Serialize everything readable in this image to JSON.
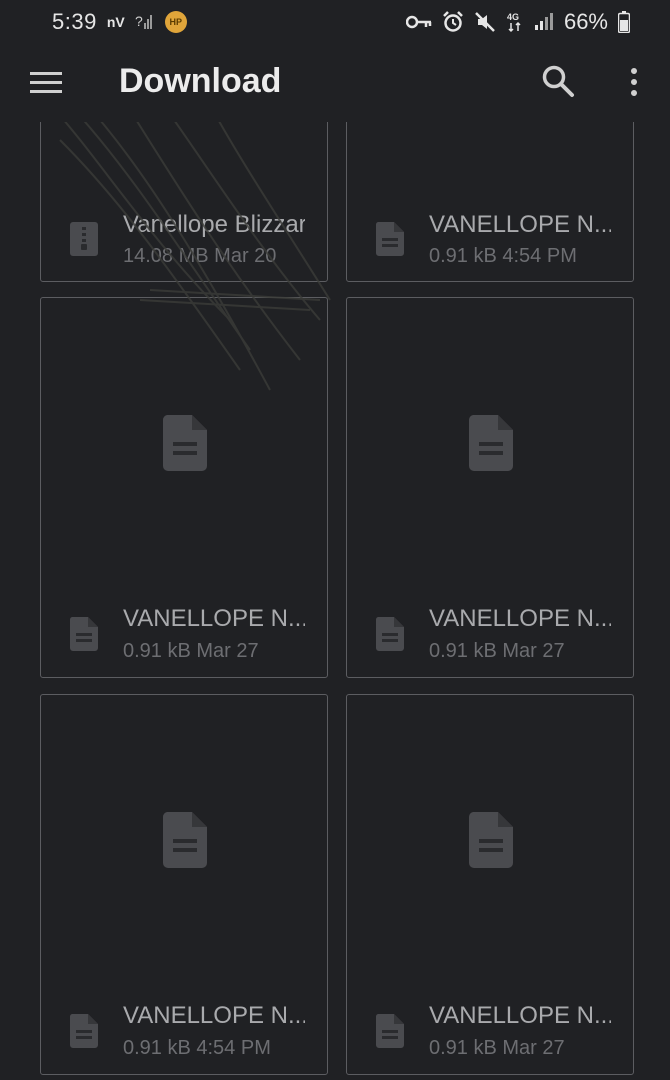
{
  "status_bar": {
    "time": "5:39",
    "carrier": "nV",
    "badge": "HP",
    "network": "4G",
    "battery": "66%"
  },
  "app_bar": {
    "title": "Download"
  },
  "files": [
    {
      "name": "Vanellope Blizzard S...",
      "meta": "14.08 MB Mar 20",
      "type": "zip"
    },
    {
      "name": "VANELLOPE N...",
      "meta": "0.91 kB 4:54 PM",
      "type": "doc"
    },
    {
      "name": "VANELLOPE N...",
      "meta": "0.91 kB Mar 27",
      "type": "doc"
    },
    {
      "name": "VANELLOPE N...",
      "meta": "0.91 kB Mar 27",
      "type": "doc"
    },
    {
      "name": "VANELLOPE N...",
      "meta": "0.91 kB 4:54 PM",
      "type": "doc"
    },
    {
      "name": "VANELLOPE N...",
      "meta": "0.91 kB Mar 27",
      "type": "doc"
    }
  ],
  "colors": {
    "background": "#202124",
    "card_border": "#5c5d61",
    "text_primary": "#a9aaad",
    "text_secondary": "#6d6e72",
    "icon": "#4a4b4f"
  }
}
